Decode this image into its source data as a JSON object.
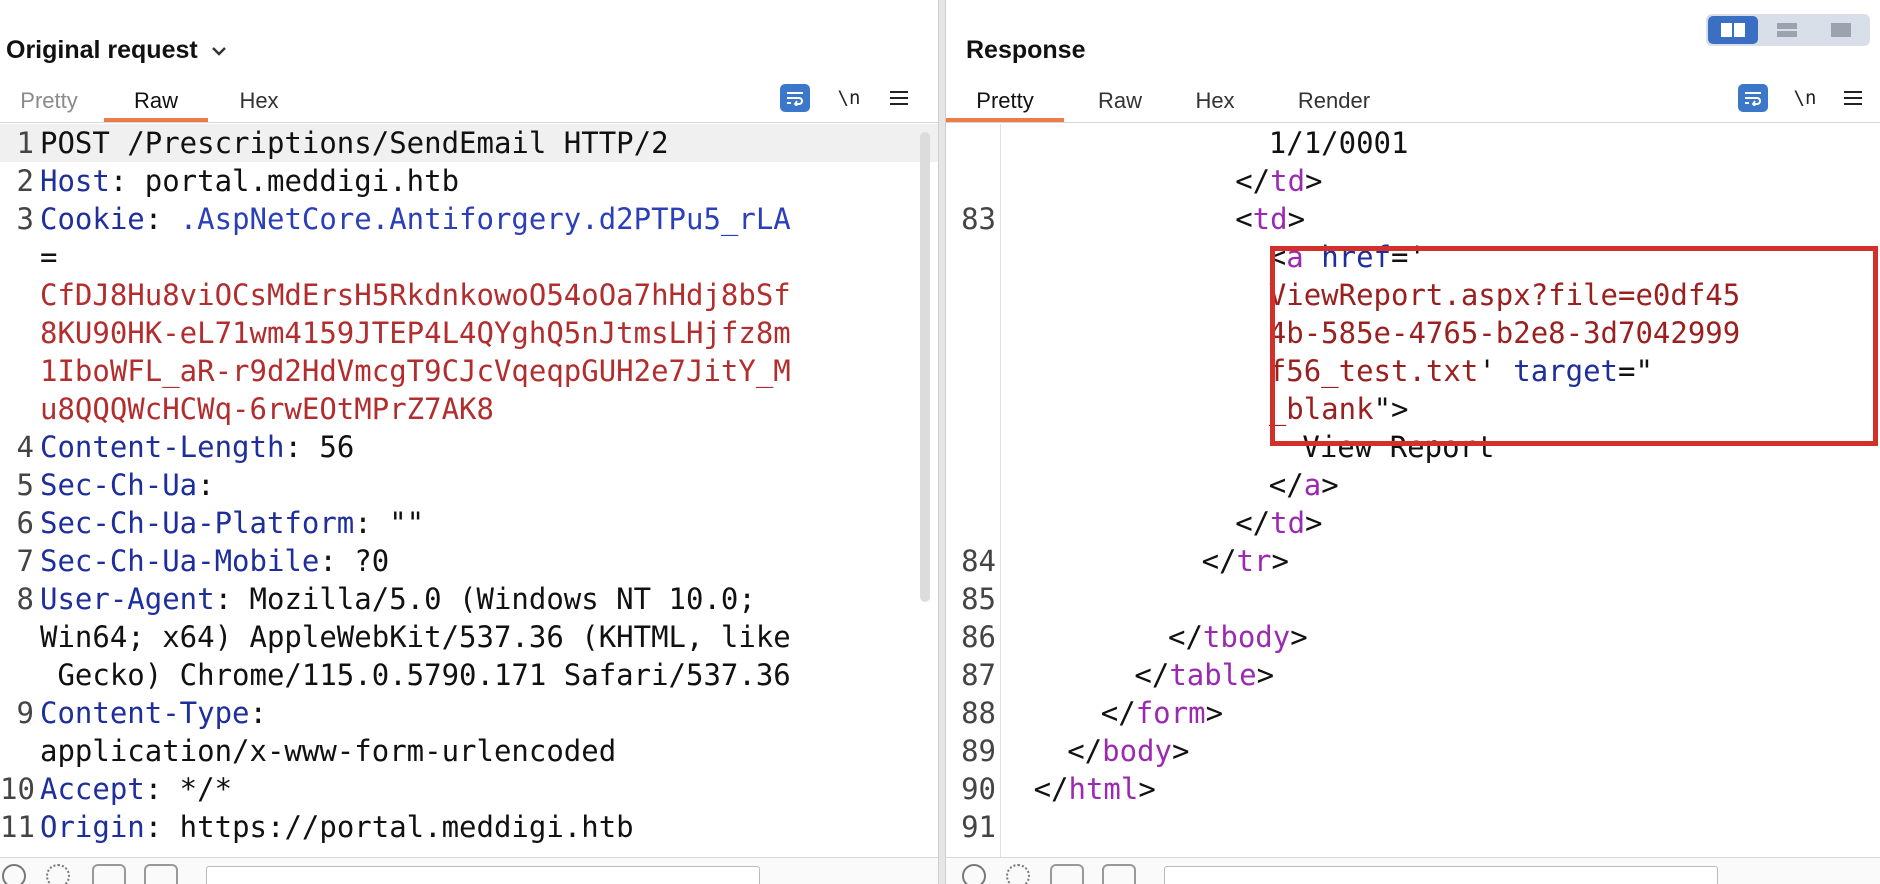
{
  "left": {
    "title": "Original request",
    "title_icon": "chevron-down-icon",
    "tabs": [
      {
        "label": "Pretty",
        "state": "dim"
      },
      {
        "label": "Raw",
        "state": "active"
      },
      {
        "label": "Hex",
        "state": "normal"
      }
    ],
    "tools": {
      "wrap_icon": "wrap-lines-icon",
      "newline_label": "\\n",
      "menu_icon": "hamburger-menu-icon"
    },
    "lines": [
      {
        "n": "1",
        "segs": [
          {
            "t": "POST /Prescriptions/SendEmail HTTP/2",
            "c": "v"
          }
        ]
      },
      {
        "n": "2",
        "segs": [
          {
            "t": "Host",
            "c": "k"
          },
          {
            "t": ": portal.meddigi.htb",
            "c": "v"
          }
        ]
      },
      {
        "n": "3",
        "segs": [
          {
            "t": "Cookie",
            "c": "k"
          },
          {
            "t": ": ",
            "c": "v"
          },
          {
            "t": ".AspNetCore.Antiforgery.d2PTPu5_rLA",
            "c": "ck"
          }
        ]
      },
      {
        "n": "",
        "segs": [
          {
            "t": "=",
            "c": "v"
          }
        ]
      },
      {
        "n": "",
        "segs": [
          {
            "t": "CfDJ8Hu8viOCsMdErsH5RkdnkowoO54oOa7hHdj8bSf",
            "c": "c"
          }
        ]
      },
      {
        "n": "",
        "segs": [
          {
            "t": "8KU90HK-eL71wm4159JTEP4L4QYghQ5nJtmsLHjfz8m",
            "c": "c"
          }
        ]
      },
      {
        "n": "",
        "segs": [
          {
            "t": "1IboWFL_aR-r9d2HdVmcgT9CJcVqeqpGUH2e7JitY_M",
            "c": "c"
          }
        ]
      },
      {
        "n": "",
        "segs": [
          {
            "t": "u8QQQWcHCWq-6rwEOtMPrZ7AK8",
            "c": "c"
          }
        ]
      },
      {
        "n": "4",
        "segs": [
          {
            "t": "Content-Length",
            "c": "k"
          },
          {
            "t": ": 56",
            "c": "v"
          }
        ]
      },
      {
        "n": "5",
        "segs": [
          {
            "t": "Sec-Ch-Ua",
            "c": "k"
          },
          {
            "t": ":",
            "c": "v"
          }
        ]
      },
      {
        "n": "6",
        "segs": [
          {
            "t": "Sec-Ch-Ua-Platform",
            "c": "k"
          },
          {
            "t": ": \"\"",
            "c": "v"
          }
        ]
      },
      {
        "n": "7",
        "segs": [
          {
            "t": "Sec-Ch-Ua-Mobile",
            "c": "k"
          },
          {
            "t": ": ?0",
            "c": "v"
          }
        ]
      },
      {
        "n": "8",
        "segs": [
          {
            "t": "User-Agent",
            "c": "k"
          },
          {
            "t": ": Mozilla/5.0 (Windows NT 10.0;",
            "c": "v"
          }
        ]
      },
      {
        "n": "",
        "segs": [
          {
            "t": "Win64; x64) AppleWebKit/537.36 (KHTML, like",
            "c": "v"
          }
        ]
      },
      {
        "n": "",
        "segs": [
          {
            "t": " Gecko) Chrome/115.0.5790.171 Safari/537.36",
            "c": "v"
          }
        ]
      },
      {
        "n": "9",
        "segs": [
          {
            "t": "Content-Type",
            "c": "k"
          },
          {
            "t": ":",
            "c": "v"
          }
        ]
      },
      {
        "n": "",
        "segs": [
          {
            "t": "application/x-www-form-urlencoded",
            "c": "v"
          }
        ]
      },
      {
        "n": "10",
        "segs": [
          {
            "t": "Accept",
            "c": "k"
          },
          {
            "t": ": */*",
            "c": "v"
          }
        ]
      },
      {
        "n": "11",
        "segs": [
          {
            "t": "Origin",
            "c": "k"
          },
          {
            "t": ": https://portal.meddigi.htb",
            "c": "v"
          }
        ]
      }
    ]
  },
  "right": {
    "title": "Response",
    "tabs": [
      {
        "label": "Pretty",
        "state": "active"
      },
      {
        "label": "Raw",
        "state": "normal"
      },
      {
        "label": "Hex",
        "state": "normal"
      },
      {
        "label": "Render",
        "state": "normal"
      }
    ],
    "tools": {
      "wrap_icon": "wrap-lines-icon",
      "newline_label": "\\n",
      "menu_icon": "hamburger-menu-icon"
    },
    "layout_buttons": [
      "split-vertical-icon",
      "split-horizontal-icon",
      "single-pane-icon"
    ],
    "lines": [
      {
        "n": "",
        "indent": 16,
        "segs": [
          {
            "t": "1/1/0001",
            "c": "v"
          }
        ]
      },
      {
        "n": "",
        "indent": 14,
        "segs": [
          {
            "t": "</",
            "c": "v"
          },
          {
            "t": "td",
            "c": "tg"
          },
          {
            "t": ">",
            "c": "v"
          }
        ]
      },
      {
        "n": "83",
        "indent": 14,
        "segs": [
          {
            "t": "<",
            "c": "v"
          },
          {
            "t": "td",
            "c": "tg"
          },
          {
            "t": ">",
            "c": "v"
          }
        ]
      },
      {
        "n": "",
        "indent": 16,
        "segs": [
          {
            "t": "<",
            "c": "v"
          },
          {
            "t": "a",
            "c": "tg"
          },
          {
            "t": " ",
            "c": "v"
          },
          {
            "t": "href",
            "c": "at"
          },
          {
            "t": "='",
            "c": "v"
          }
        ]
      },
      {
        "n": "",
        "indent": 16,
        "segs": [
          {
            "t": "ViewReport.aspx?file=e0df45",
            "c": "av"
          }
        ]
      },
      {
        "n": "",
        "indent": 16,
        "segs": [
          {
            "t": "4b-585e-4765-b2e8-3d7042999",
            "c": "av"
          }
        ]
      },
      {
        "n": "",
        "indent": 16,
        "segs": [
          {
            "t": "f56_test.txt",
            "c": "av"
          },
          {
            "t": "' ",
            "c": "v"
          },
          {
            "t": "target",
            "c": "at"
          },
          {
            "t": "=\"",
            "c": "v"
          }
        ]
      },
      {
        "n": "",
        "indent": 16,
        "segs": [
          {
            "t": "_blank",
            "c": "av"
          },
          {
            "t": "\">",
            "c": "v"
          }
        ]
      },
      {
        "n": "",
        "indent": 18,
        "segs": [
          {
            "t": "View Report",
            "c": "v"
          }
        ]
      },
      {
        "n": "",
        "indent": 16,
        "segs": [
          {
            "t": "</",
            "c": "v"
          },
          {
            "t": "a",
            "c": "tg"
          },
          {
            "t": ">",
            "c": "v"
          }
        ]
      },
      {
        "n": "",
        "indent": 14,
        "segs": [
          {
            "t": "</",
            "c": "v"
          },
          {
            "t": "td",
            "c": "tg"
          },
          {
            "t": ">",
            "c": "v"
          }
        ]
      },
      {
        "n": "84",
        "indent": 12,
        "segs": [
          {
            "t": "</",
            "c": "v"
          },
          {
            "t": "tr",
            "c": "tg"
          },
          {
            "t": ">",
            "c": "v"
          }
        ]
      },
      {
        "n": "85",
        "indent": 0,
        "segs": []
      },
      {
        "n": "86",
        "indent": 10,
        "segs": [
          {
            "t": "</",
            "c": "v"
          },
          {
            "t": "tbody",
            "c": "tg"
          },
          {
            "t": ">",
            "c": "v"
          }
        ]
      },
      {
        "n": "87",
        "indent": 8,
        "segs": [
          {
            "t": "</",
            "c": "v"
          },
          {
            "t": "table",
            "c": "tg"
          },
          {
            "t": ">",
            "c": "v"
          }
        ]
      },
      {
        "n": "88",
        "indent": 6,
        "segs": [
          {
            "t": "</",
            "c": "v"
          },
          {
            "t": "form",
            "c": "tg"
          },
          {
            "t": ">",
            "c": "v"
          }
        ]
      },
      {
        "n": "89",
        "indent": 4,
        "segs": [
          {
            "t": "</",
            "c": "v"
          },
          {
            "t": "body",
            "c": "tg"
          },
          {
            "t": ">",
            "c": "v"
          }
        ]
      },
      {
        "n": "90",
        "indent": 2,
        "segs": [
          {
            "t": "</",
            "c": "v"
          },
          {
            "t": "html",
            "c": "tg"
          },
          {
            "t": ">",
            "c": "v"
          }
        ]
      },
      {
        "n": "91",
        "indent": 0,
        "segs": []
      }
    ]
  },
  "colors": {
    "accent_tab": "#ec7a4a",
    "highlight_box": "#d3302a",
    "icon_blue": "#3b78c9"
  }
}
